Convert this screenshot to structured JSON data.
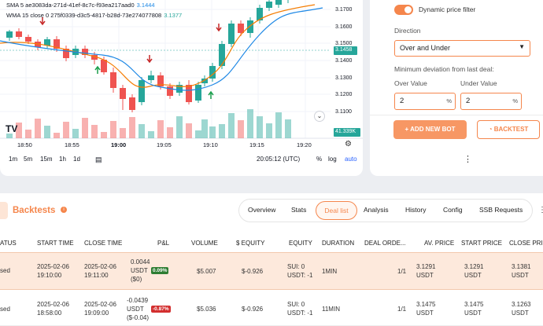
{
  "chart": {
    "legend_sma": "SMA 5 ae3083da-271d-41ef-8c7c-f93ea217aad0",
    "legend_sma_value": "3.1444",
    "legend_wma": "WMA 15 close 0 275f0339-d3c5-4817-b28d-73e274077808",
    "legend_wma_value": "3.1377",
    "price_labels": [
      "3.1700",
      "3.1600",
      "3.1500",
      "3.1400",
      "3.1300",
      "3.1200",
      "3.1100"
    ],
    "current_price": "3.1458",
    "volume_tag": "41.339K",
    "time_labels": [
      "18:50",
      "18:55",
      "19:00",
      "19:05",
      "19:10",
      "19:15",
      "19:20"
    ],
    "timeframes": [
      "1m",
      "5m",
      "15m",
      "1h",
      "1d"
    ],
    "clock": "20:05:12 (UTC)",
    "pct": "%",
    "log": "log",
    "auto": "auto",
    "colors": {
      "up": "#26a69a",
      "down": "#ef5350",
      "sma": "#1e88e5",
      "wma": "#f57c00"
    }
  },
  "panel": {
    "filter_label": "Dynamic price filter",
    "direction_label": "Direction",
    "direction_value": "Over and Under",
    "min_dev_label": "Minimum deviation from last deal:",
    "over_label": "Over Value",
    "under_label": "Under Value",
    "over_value": "2",
    "under_value": "2",
    "unit": "%",
    "add_bot": "ADD NEW BOT",
    "backtest": "BACKTEST"
  },
  "backtests": {
    "title": "Backtests",
    "tabs": [
      "Overview",
      "Stats",
      "Deal list",
      "Analysis",
      "History",
      "Config",
      "SSB Requests"
    ],
    "active_tab": "Deal list",
    "headers": [
      "ATUS",
      "START TIME",
      "CLOSE TIME",
      "P&L",
      "VOLUME",
      "$ EQUITY",
      "EQUITY",
      "DURATION",
      "DEAL ORDE...",
      "AV. PRICE",
      "START PRICE",
      "CLOSE PRIC"
    ],
    "rows": [
      {
        "status": "sed",
        "start_date": "2025-02-06",
        "start_time": "19:10:00",
        "close_date": "2025-02-06",
        "close_time": "19:11:00",
        "pnl_1": "0.0044",
        "pnl_2": "USDT",
        "pnl_3": "($0)",
        "pnl_pct": "0.09%",
        "volume": "$5.007",
        "usd_equity": "$-0.926",
        "equity_1": "SUI: 0",
        "equity_2": "USDT: -1",
        "duration": "1MIN",
        "deal_orders": "1/1",
        "av_price": "3.1291",
        "start_price": "3.1291",
        "close_price": "3.1381",
        "unit": "USDT"
      },
      {
        "status": "sed",
        "start_date": "2025-02-06",
        "start_time": "18:58:00",
        "close_date": "2025-02-06",
        "close_time": "19:09:00",
        "pnl_1": "-0.0439",
        "pnl_2": "USDT",
        "pnl_3": "($-0.04)",
        "pnl_pct": "-0.87%",
        "volume": "$5.036",
        "usd_equity": "$-0.926",
        "equity_1": "SUI: 0",
        "equity_2": "USDT: -1",
        "duration": "11MIN",
        "deal_orders": "1/1",
        "av_price": "3.1475",
        "start_price": "3.1475",
        "close_price": "3.1263",
        "unit": "USDT"
      }
    ]
  }
}
